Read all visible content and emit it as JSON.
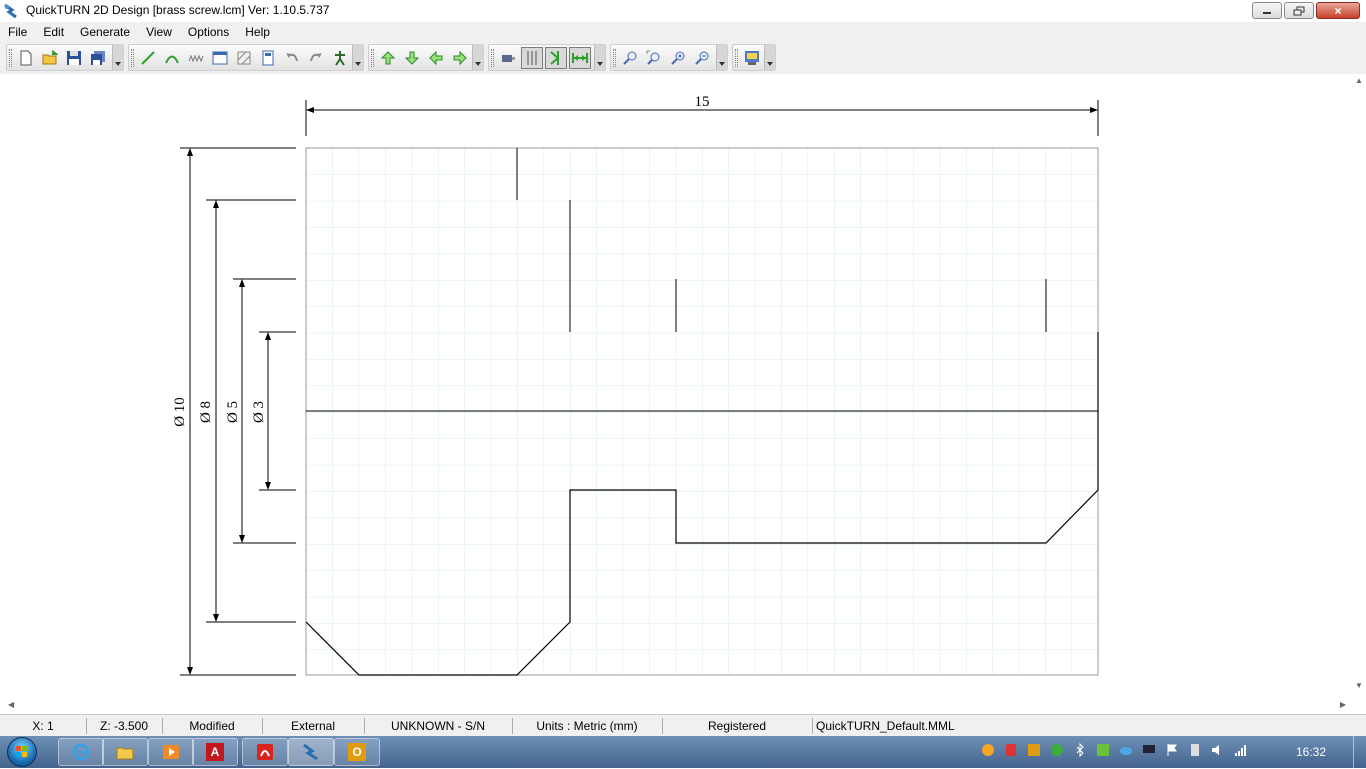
{
  "window": {
    "title": "QuickTURN 2D Design [brass screw.lcm] Ver: 1.10.5.737",
    "close_glyph": "×"
  },
  "menu": [
    "File",
    "Edit",
    "Generate",
    "View",
    "Options",
    "Help"
  ],
  "drawing": {
    "length_dim": "15",
    "diameter_dims": [
      "Ø 10",
      "Ø 8",
      "Ø 5",
      "Ø 3"
    ]
  },
  "status": {
    "x": "X: 1",
    "z": "Z: -3.500",
    "modified": "Modified",
    "external": "External",
    "serial": "UNKNOWN - S/N",
    "units": "Units : Metric (mm)",
    "registration": "Registered",
    "material_file": "QuickTURN_Default.MML"
  },
  "taskbar": {
    "clock": "16:32",
    "acrobat_glyph": "A",
    "outlook_glyph": "O"
  },
  "colors": {
    "grid": "#d6ece4",
    "accent_green": "#2ca02c",
    "taskbar": "#4f6f99"
  }
}
